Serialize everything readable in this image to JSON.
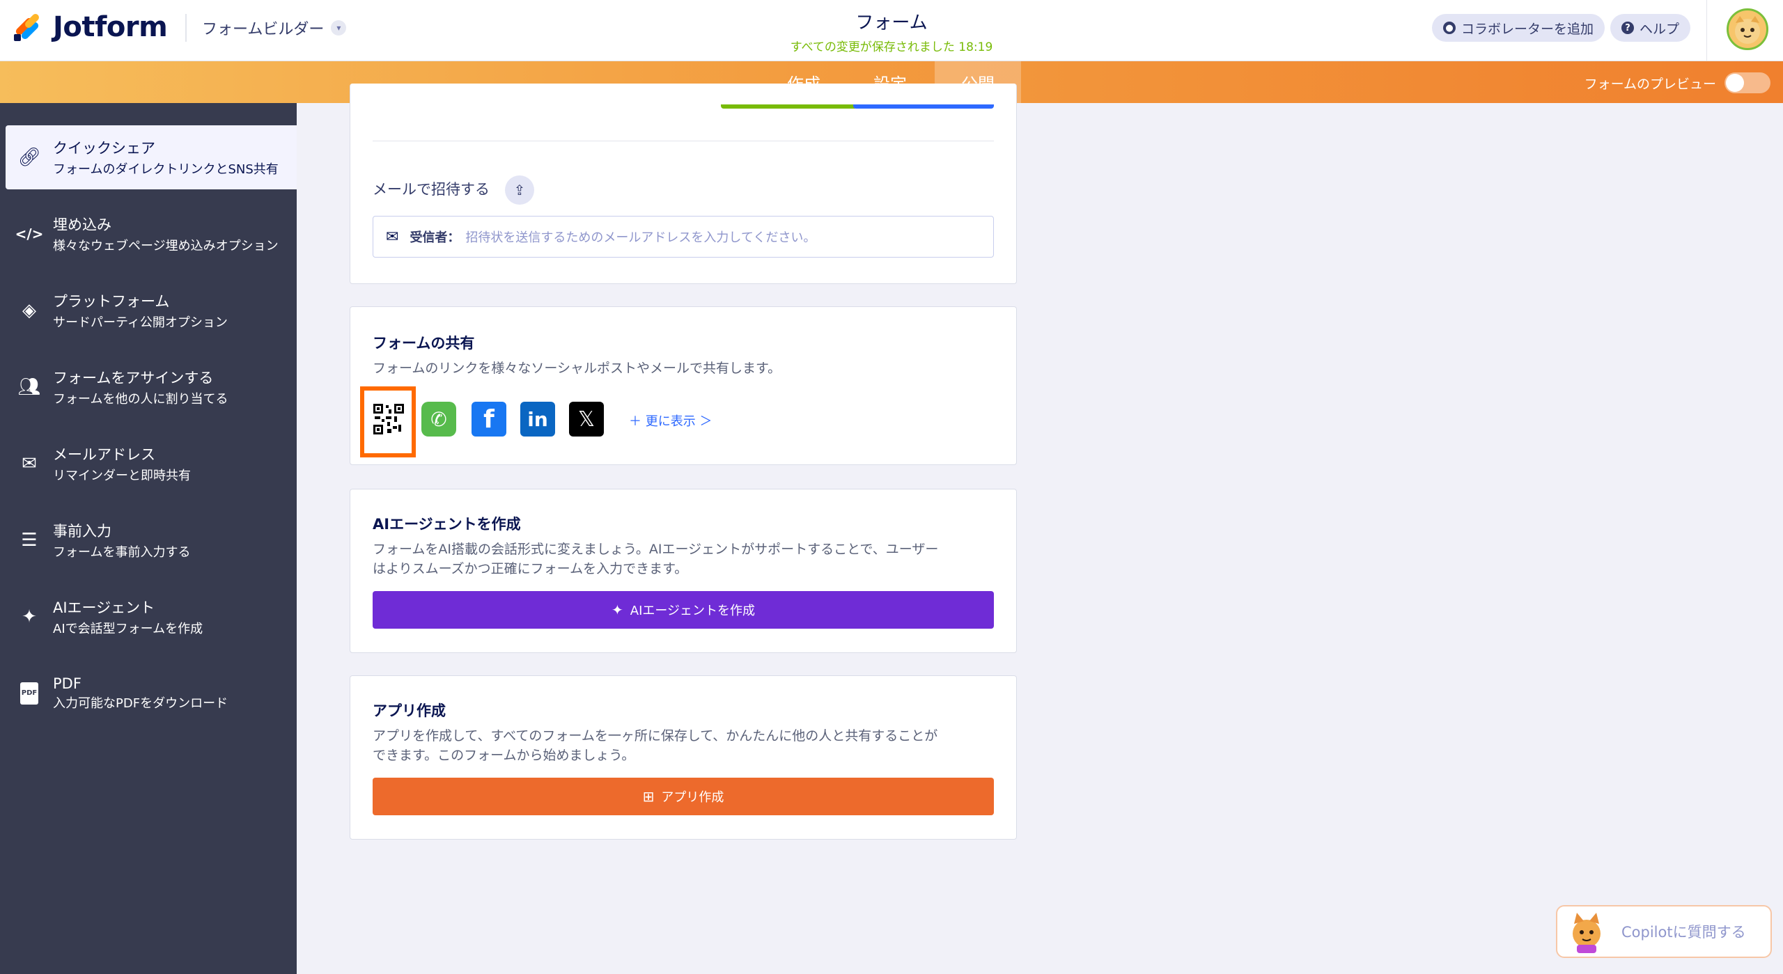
{
  "header": {
    "logo_text": "Jotform",
    "builder_label": "フォームビルダー",
    "form_title": "フォーム",
    "save_status": "すべての変更が保存されました 18:19",
    "add_collaborator": "コラボレーターを追加",
    "help": "ヘルプ"
  },
  "nav": {
    "tabs": [
      {
        "label": "作成"
      },
      {
        "label": "設定"
      },
      {
        "label": "公開"
      }
    ],
    "active_tab": "公開",
    "preview_label": "フォームのプレビュー"
  },
  "sidebar": {
    "items": [
      {
        "title": "クイックシェア",
        "subtitle": "フォームのダイレクトリンクとSNS共有",
        "icon": "link-icon"
      },
      {
        "title": "埋め込み",
        "subtitle": "様々なウェブページ埋め込みオプション",
        "icon": "code-icon"
      },
      {
        "title": "プラットフォーム",
        "subtitle": "サードパーティ公開オプション",
        "icon": "layers-icon"
      },
      {
        "title": "フォームをアサインする",
        "subtitle": "フォームを他の人に割り当てる",
        "icon": "users-icon"
      },
      {
        "title": "メールアドレス",
        "subtitle": "リマインダーと即時共有",
        "icon": "mail-icon"
      },
      {
        "title": "事前入力",
        "subtitle": "フォームを事前入力する",
        "icon": "prefill-icon"
      },
      {
        "title": "AIエージェント",
        "subtitle": "AIで会話型フォームを作成",
        "icon": "sparkle-icon"
      },
      {
        "title": "PDF",
        "subtitle": "入力可能なPDFをダウンロード",
        "icon": "pdf-icon"
      }
    ]
  },
  "email_invite": {
    "title": "メールで招待する",
    "recipient_label": "受信者：",
    "placeholder": "招待状を送信するためのメールアドレスを入力してください。"
  },
  "share": {
    "title": "フォームの共有",
    "description": "フォームのリンクを様々なソーシャルポストやメールで共有します。",
    "more_label": "＋ 更に表示 ＞",
    "services": [
      "qr-code",
      "whatsapp",
      "facebook",
      "linkedin",
      "x"
    ]
  },
  "ai_agent": {
    "title": "AIエージェントを作成",
    "description_line1": "フォームをAI搭載の会話形式に変えましょう。AIエージェントがサポートすることで、ユーザー",
    "description_line2": "はよりスムーズかつ正確にフォームを入力できます。",
    "button": "AIエージェントを作成"
  },
  "app": {
    "title": "アプリ作成",
    "description_line1": "アプリを作成して、すべてのフォームを一ヶ所に保存して、かんたんに他の人と共有することが",
    "description_line2": "できます。このフォームから始めましょう。",
    "button": "アプリ作成"
  },
  "copilot": {
    "label": "Copilotに質問する"
  },
  "colors": {
    "accent_orange": "#f0802e",
    "ai_purple": "#6f2cd6",
    "app_orange": "#ed6a2c",
    "highlight": "#ff6a00"
  }
}
